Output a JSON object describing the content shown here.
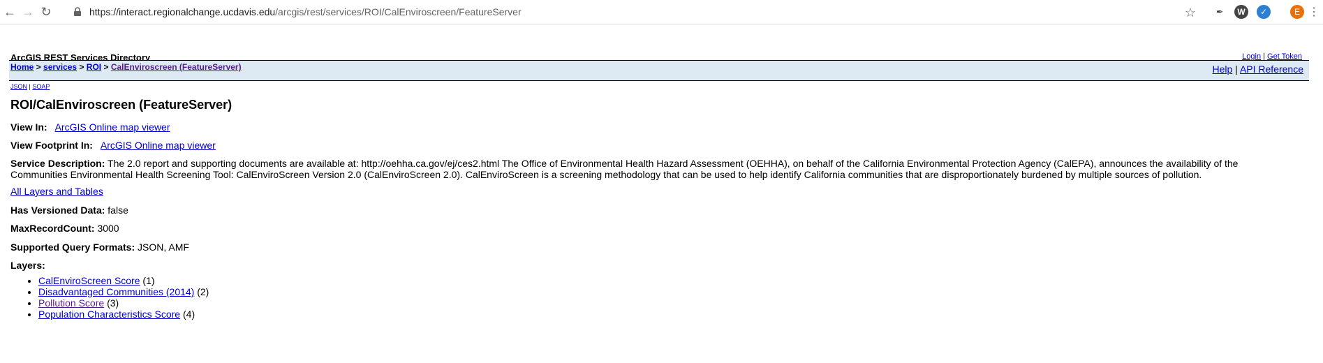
{
  "browser": {
    "url_host": "https://interact.regionalchange.ucdavis.edu",
    "url_path": "/arcgis/rest/services/ROI/CalEnviroscreen/FeatureServer",
    "profile_initial": "E"
  },
  "header": {
    "directory_title": "ArcGIS REST Services Directory",
    "login": "Login",
    "separator": "|",
    "get_token": "Get Token"
  },
  "breadcrumb": {
    "home": "Home",
    "services": "services",
    "roi": "ROI",
    "current": "CalEnviroscreen (FeatureServer)",
    "sep": ">"
  },
  "help": {
    "help": "Help",
    "api_reference": "API Reference"
  },
  "formats": {
    "json": "JSON",
    "soap": "SOAP"
  },
  "page_title": "ROI/CalEnviroscreen (FeatureServer)",
  "view_in": {
    "label": "View In:",
    "link": "ArcGIS Online map viewer"
  },
  "view_footprint": {
    "label": "View Footprint In:",
    "link": "ArcGIS Online map viewer"
  },
  "service_description": {
    "label": "Service Description:",
    "text": "The 2.0 report and supporting documents are available at: http://oehha.ca.gov/ej/ces2.html The Office of Environmental Health Hazard Assessment (OEHHA), on behalf of the California Environmental Protection Agency (CalEPA), announces the availability of the Communities Environmental Health Screening Tool: CalEnviroScreen Version 2.0 (CalEnviroScreen 2.0). CalEnviroScreen is a screening methodology that can be used to help identify California communities that are disproportionately burdened by multiple sources of pollution."
  },
  "all_layers_link": "All Layers and Tables",
  "has_versioned_data": {
    "label": "Has Versioned Data:",
    "value": "false"
  },
  "max_record_count": {
    "label": "MaxRecordCount:",
    "value": "3000"
  },
  "supported_query_formats": {
    "label": "Supported Query Formats:",
    "value": "JSON, AMF"
  },
  "layers_label": "Layers:",
  "layers": [
    {
      "name": "CalEnviroScreen Score",
      "id": "(1)"
    },
    {
      "name": "Disadvantaged Communities (2014)",
      "id": "(2)"
    },
    {
      "name": "Pollution Score",
      "id": "(3)"
    },
    {
      "name": "Population Characteristics Score",
      "id": "(4)"
    }
  ]
}
